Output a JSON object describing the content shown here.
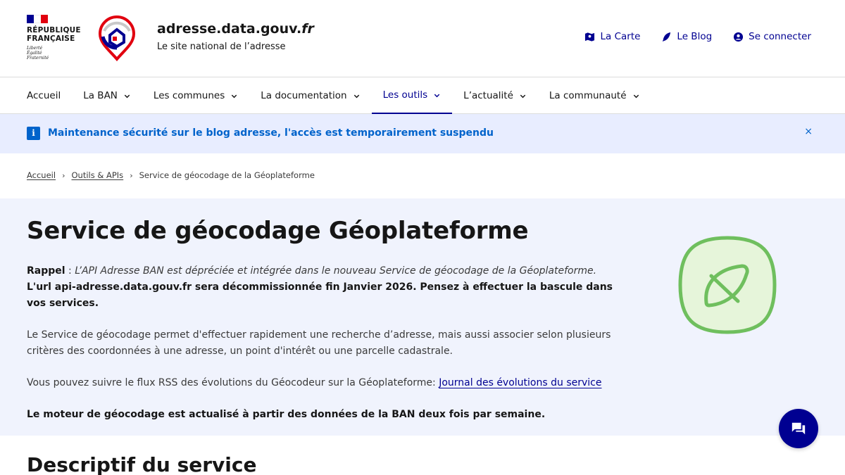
{
  "header": {
    "republique": [
      "RÉPUBLIQUE",
      "FRANÇAISE"
    ],
    "motto": [
      "Liberté",
      "Égalité",
      "Fraternité"
    ],
    "site_name": "adresse.data.gouv.",
    "site_name_tld": "fr",
    "tagline": "Le site national de l’adresse",
    "quick_links": [
      {
        "label": "La Carte",
        "icon": "map-icon"
      },
      {
        "label": "Le Blog",
        "icon": "feather-icon"
      },
      {
        "label": "Se connecter",
        "icon": "user-icon"
      }
    ]
  },
  "nav": {
    "items": [
      {
        "label": "Accueil",
        "dropdown": false,
        "active": false
      },
      {
        "label": "La BAN",
        "dropdown": true,
        "active": false
      },
      {
        "label": "Les communes",
        "dropdown": true,
        "active": false
      },
      {
        "label": "La documentation",
        "dropdown": true,
        "active": false
      },
      {
        "label": "Les outils",
        "dropdown": true,
        "active": true
      },
      {
        "label": "L’actualité",
        "dropdown": true,
        "active": false
      },
      {
        "label": "La communauté",
        "dropdown": true,
        "active": false
      }
    ]
  },
  "notice": {
    "icon": "i",
    "text": "Maintenance sécurité sur le blog adresse, l'accès est temporairement suspendu",
    "close": "×"
  },
  "breadcrumb": {
    "items": [
      "Accueil",
      "Outils & APIs"
    ],
    "current": "Service de géocodage de la Géoplateforme"
  },
  "hero": {
    "title": "Service de géocodage Géoplateforme",
    "rappel_label": "Rappel",
    "rappel_sep": " : ",
    "rappel_text": "L’API Adresse BAN est dépréciée et intégrée dans le nouveau Service de géocodage de la Géoplateforme.",
    "rappel_bold": "L'url api-adresse.data.gouv.fr sera décommissionnée fin Janvier 2026. Pensez à effectuer la bascule dans vos services.",
    "paragraph1": "Le Service de géocodage permet d'effectuer rapidement une recherche d’adresse, mais aussi associer selon plusieurs critères des coordonnées à une adresse, un point d'intérêt ou une parcelle cadastrale.",
    "paragraph2_prefix": "Vous pouvez suivre le flux RSS des évolutions du Géocodeur sur la Géoplateforme: ",
    "paragraph2_link": "Journal des évolutions du service",
    "paragraph3": "Le moteur de géocodage est actualisé à partir des données de la BAN deux fois par semaine."
  },
  "section": {
    "title": "Descriptif du service"
  },
  "colors": {
    "primary": "#000091",
    "notice_bg": "#e8edff",
    "notice_text": "#0063cb",
    "hero_bg": "#f0f3fd",
    "illustration": "#6fbf5e"
  }
}
